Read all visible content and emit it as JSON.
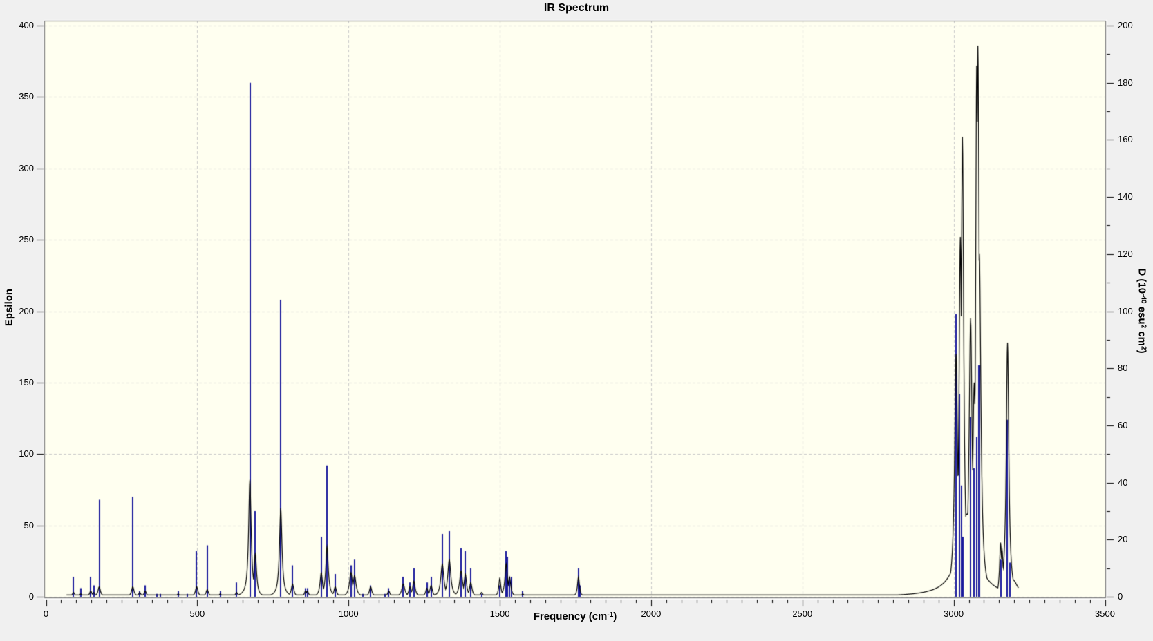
{
  "window": {
    "background_color": "#f0f0f0",
    "plot_background_color": "#fffff0"
  },
  "chart_data": {
    "type": "line",
    "subtype": "ir-spectrum-sticks-plus-lorentzian-envelope",
    "title": "IR Spectrum",
    "xlabel_segments": [
      {
        "t": "Frequency (cm"
      },
      {
        "t": "-1",
        "sup": true
      },
      {
        "t": ")"
      }
    ],
    "ylabel_left": "Epsilon",
    "ylabel_right_segments": [
      {
        "t": "D (10"
      },
      {
        "t": "-40",
        "sup": true
      },
      {
        "t": " esu"
      },
      {
        "t": "2",
        "sup": true
      },
      {
        "t": " cm"
      },
      {
        "t": "2",
        "sup": true
      },
      {
        "t": ")"
      }
    ],
    "x_axis": {
      "min": 0,
      "max": 3500,
      "major_tick": 500,
      "minor_tick": 50,
      "tick_labels": [
        "0",
        "500",
        "1000",
        "1500",
        "2000",
        "2500",
        "3000",
        "3500"
      ]
    },
    "y_left": {
      "min": 0,
      "max": 400,
      "major_tick": 50,
      "tick_labels": [
        "400",
        "350",
        "300",
        "250",
        "200",
        "150",
        "100",
        "50",
        "0"
      ]
    },
    "y_right": {
      "min": 0,
      "max": 200,
      "major_tick": 20,
      "minor_tick": 10,
      "tick_labels": [
        "200",
        "180",
        "160",
        "140",
        "120",
        "100",
        "80",
        "60",
        "40",
        "20",
        "0"
      ]
    },
    "grid": {
      "x_step": 500,
      "y_left_step": 50,
      "style": "dashed"
    },
    "legend": "none",
    "colors": {
      "stick": "#1a1a9c",
      "envelope": "#000000",
      "grid": "#c9c9c9",
      "frame": "#7d7d7d",
      "frame_highlight": "#ffffff",
      "tick": "#000000",
      "plot_bg": "#fffff0"
    },
    "sticks_units": "[frequency_cm-1, D_10^-40_esu2cm2]",
    "sticks": [
      [
        91,
        7
      ],
      [
        115,
        3
      ],
      [
        148,
        7
      ],
      [
        158,
        4
      ],
      [
        176,
        34
      ],
      [
        287,
        35
      ],
      [
        310,
        2
      ],
      [
        328,
        4
      ],
      [
        366,
        1
      ],
      [
        377,
        1
      ],
      [
        437,
        2
      ],
      [
        467,
        1
      ],
      [
        498,
        16
      ],
      [
        533,
        18
      ],
      [
        576,
        2
      ],
      [
        630,
        5
      ],
      [
        674,
        180
      ],
      [
        692,
        30
      ],
      [
        776,
        104
      ],
      [
        815,
        11
      ],
      [
        858,
        3
      ],
      [
        864,
        3
      ],
      [
        910,
        21
      ],
      [
        929,
        46
      ],
      [
        956,
        8
      ],
      [
        1008,
        11
      ],
      [
        1020,
        13
      ],
      [
        1047,
        1
      ],
      [
        1073,
        4
      ],
      [
        1120,
        1
      ],
      [
        1133,
        3
      ],
      [
        1181,
        7
      ],
      [
        1203,
        5
      ],
      [
        1216,
        10
      ],
      [
        1259,
        5
      ],
      [
        1273,
        7
      ],
      [
        1310,
        22
      ],
      [
        1333,
        23
      ],
      [
        1372,
        17
      ],
      [
        1386,
        16
      ],
      [
        1404,
        10
      ],
      [
        1440,
        1
      ],
      [
        1500,
        4
      ],
      [
        1520,
        16
      ],
      [
        1524,
        14
      ],
      [
        1532,
        7
      ],
      [
        1538,
        7
      ],
      [
        1576,
        2
      ],
      [
        1760,
        10
      ],
      [
        1765,
        4
      ],
      [
        3008,
        99
      ],
      [
        3019,
        71
      ],
      [
        3026,
        39
      ],
      [
        3029,
        21
      ],
      [
        3031,
        21
      ],
      [
        3056,
        63
      ],
      [
        3068,
        45
      ],
      [
        3076,
        56
      ],
      [
        3083,
        81
      ],
      [
        3086,
        81
      ],
      [
        3156,
        13
      ],
      [
        3176,
        62
      ],
      [
        3185,
        12
      ]
    ],
    "envelope_units": "[frequency_cm-1, epsilon_peak, lorentzian_hwhm_cm-1]",
    "envelope_peaks": [
      [
        91,
        3,
        5
      ],
      [
        115,
        2,
        5
      ],
      [
        148,
        4,
        5
      ],
      [
        158,
        3,
        5
      ],
      [
        176,
        7,
        5
      ],
      [
        287,
        7,
        5
      ],
      [
        310,
        3,
        5
      ],
      [
        328,
        4,
        5
      ],
      [
        437,
        2,
        5
      ],
      [
        498,
        7,
        5
      ],
      [
        533,
        5,
        5
      ],
      [
        576,
        2,
        5
      ],
      [
        630,
        3,
        5
      ],
      [
        674,
        82,
        5
      ],
      [
        692,
        30,
        5
      ],
      [
        776,
        62,
        5
      ],
      [
        815,
        9,
        5
      ],
      [
        858,
        4,
        5
      ],
      [
        864,
        4,
        5
      ],
      [
        910,
        17,
        5
      ],
      [
        929,
        35,
        5
      ],
      [
        956,
        7,
        5
      ],
      [
        1008,
        17,
        6
      ],
      [
        1020,
        15,
        6
      ],
      [
        1073,
        7,
        5
      ],
      [
        1133,
        4,
        5
      ],
      [
        1181,
        9,
        6
      ],
      [
        1203,
        7,
        5
      ],
      [
        1216,
        11,
        5
      ],
      [
        1259,
        6,
        5
      ],
      [
        1273,
        8,
        5
      ],
      [
        1310,
        23,
        6
      ],
      [
        1333,
        26,
        6
      ],
      [
        1372,
        18,
        6
      ],
      [
        1386,
        16,
        5
      ],
      [
        1404,
        10,
        5
      ],
      [
        1440,
        3,
        5
      ],
      [
        1500,
        13,
        4
      ],
      [
        1521,
        23,
        5
      ],
      [
        1532,
        14,
        5
      ],
      [
        1576,
        2,
        5
      ],
      [
        1760,
        14,
        4
      ],
      [
        3008,
        170,
        6
      ],
      [
        3022,
        252,
        5
      ],
      [
        3029,
        322,
        5
      ],
      [
        3045,
        58,
        35
      ],
      [
        3056,
        195,
        6
      ],
      [
        3068,
        150,
        6
      ],
      [
        3076,
        372,
        4
      ],
      [
        3080,
        386,
        5
      ],
      [
        3085,
        240,
        6
      ],
      [
        3155,
        38,
        4
      ],
      [
        3160,
        33,
        4
      ],
      [
        3178,
        178,
        5
      ],
      [
        3195,
        12,
        20
      ]
    ],
    "envelope_baseline_epsilon": 1.3,
    "envelope_frequency_range": [
      68,
      3214
    ]
  }
}
